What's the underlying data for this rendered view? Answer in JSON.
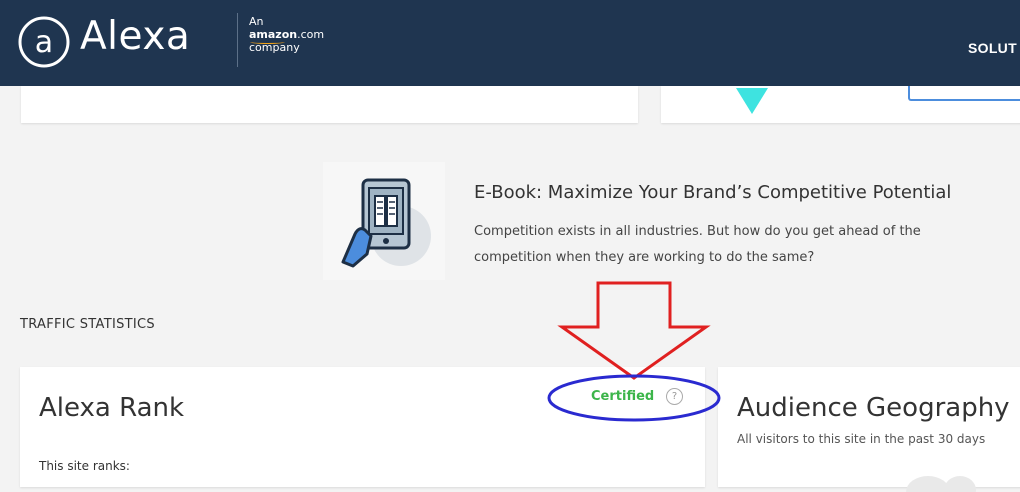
{
  "header": {
    "brand": "Alexa",
    "amazon_line1": "An",
    "amazon_word": "amazon",
    "amazon_com": ".com",
    "amazon_line3": "company",
    "nav_item": "SOLUT"
  },
  "promo": {
    "title": "E-Book: Maximize Your Brand’s Competitive Potential",
    "body": "Competition exists in all industries. But how do you get ahead of the competition when they are working to do the same?"
  },
  "section": {
    "title": "TRAFFIC STATISTICS"
  },
  "rank_card": {
    "title": "Alexa Rank",
    "certified": "Certified",
    "help_glyph": "?",
    "subtitle": "This site ranks:"
  },
  "geo_card": {
    "title": "Audience Geography",
    "subtitle": "All visitors to this site in the past 30 days"
  },
  "colors": {
    "header_bg": "#1f3550",
    "certified_green": "#3cb54a",
    "annotation_red": "#e02020",
    "annotation_blue": "#2a2ad0",
    "teal": "#3ee3e0"
  },
  "icons": {
    "logo": "alexa-a-circle-icon",
    "ebook": "tablet-book-icon",
    "help": "question-circle-icon"
  }
}
